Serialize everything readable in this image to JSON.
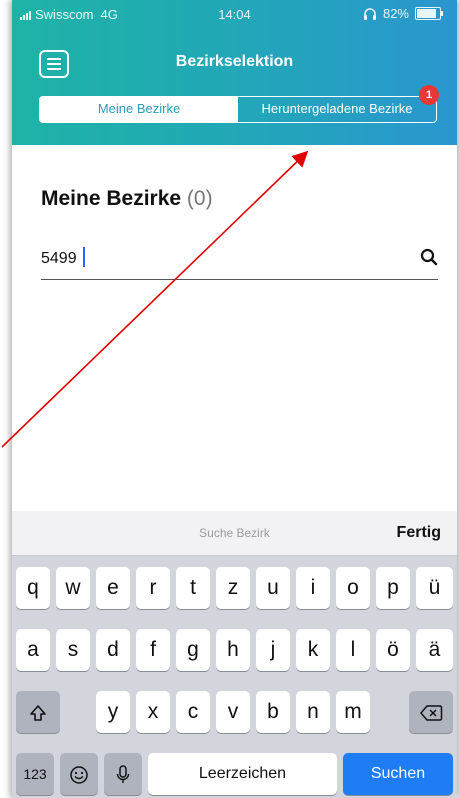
{
  "status_bar": {
    "carrier": "Swisscom",
    "network": "4G",
    "time": "14:04",
    "battery": "82%"
  },
  "header": {
    "title": "Bezirkselektion",
    "tabs": [
      {
        "label": "Meine Bezirke",
        "active": true
      },
      {
        "label": "Heruntergeladene Bezirke",
        "active": false,
        "badge": "1"
      }
    ],
    "colors": {
      "gradient_start": "#1fb3a6",
      "gradient_end": "#2a96cf",
      "badge": "#e53935"
    }
  },
  "main": {
    "section_title": "Meine Bezirke",
    "section_count": "(0)",
    "search": {
      "value": "5499",
      "icon": "search-icon"
    }
  },
  "keyboard": {
    "hint": "Suche Bezirk",
    "done_label": "Fertig",
    "rows": [
      [
        "q",
        "w",
        "e",
        "r",
        "t",
        "z",
        "u",
        "i",
        "o",
        "p",
        "ü"
      ],
      [
        "a",
        "s",
        "d",
        "f",
        "g",
        "h",
        "j",
        "k",
        "l",
        "ö",
        "ä"
      ],
      [
        "y",
        "x",
        "c",
        "v",
        "b",
        "n",
        "m"
      ]
    ],
    "shift_icon": "shift-icon",
    "backspace_icon": "backspace-icon",
    "numbers_label": "123",
    "emoji_icon": "emoji-icon",
    "mic_icon": "microphone-icon",
    "space_label": "Leerzeichen",
    "action_label": "Suchen",
    "action_color": "#1e7cf5"
  }
}
